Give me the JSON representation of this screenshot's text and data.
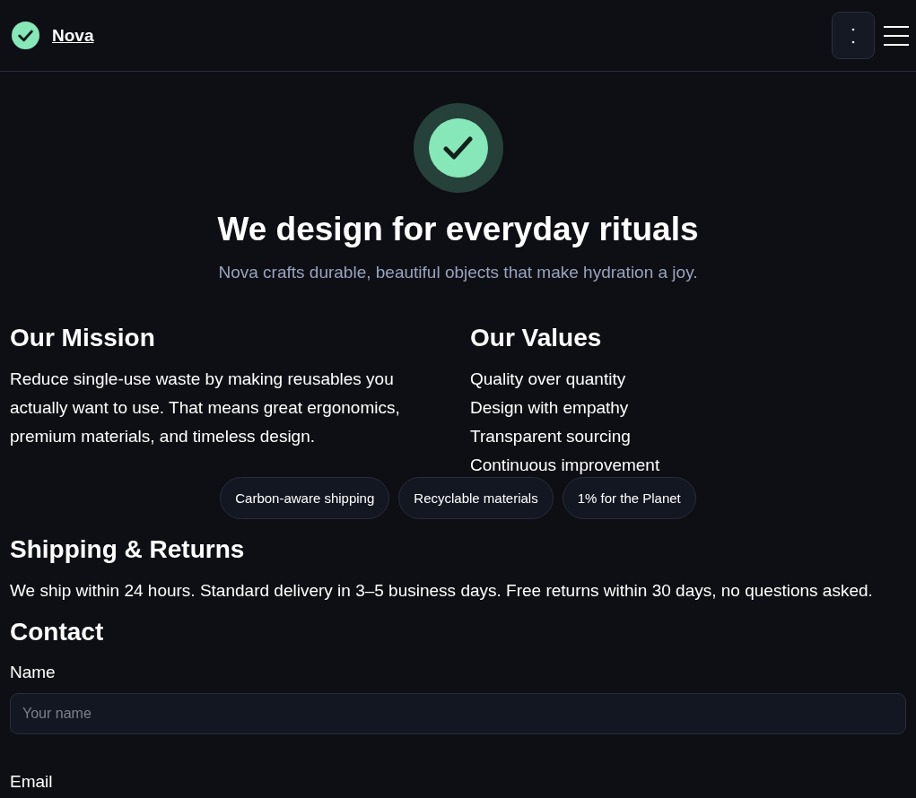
{
  "header": {
    "brand": "Nova"
  },
  "hero": {
    "title": "We design for everyday rituals",
    "subtitle": "Nova crafts durable, beautiful objects that make hydration a joy."
  },
  "mission": {
    "heading": "Our Mission",
    "text": "Reduce single-use waste by making reusables you actually want to use. That means great ergonomics, premium materials, and timeless design."
  },
  "values": {
    "heading": "Our Values",
    "items": [
      "Quality over quantity",
      "Design with empathy",
      "Transparent sourcing",
      "Continuous improvement"
    ]
  },
  "badges": [
    "Carbon-aware shipping",
    "Recyclable materials",
    "1% for the Planet"
  ],
  "shipping": {
    "heading": "Shipping & Returns",
    "text": "We ship within 24 hours. Standard delivery in 3–5 business days. Free returns within 30 days, no questions asked."
  },
  "contact": {
    "heading": "Contact",
    "fields": [
      {
        "label": "Name",
        "placeholder": "Your name"
      },
      {
        "label": "Email"
      }
    ]
  }
}
